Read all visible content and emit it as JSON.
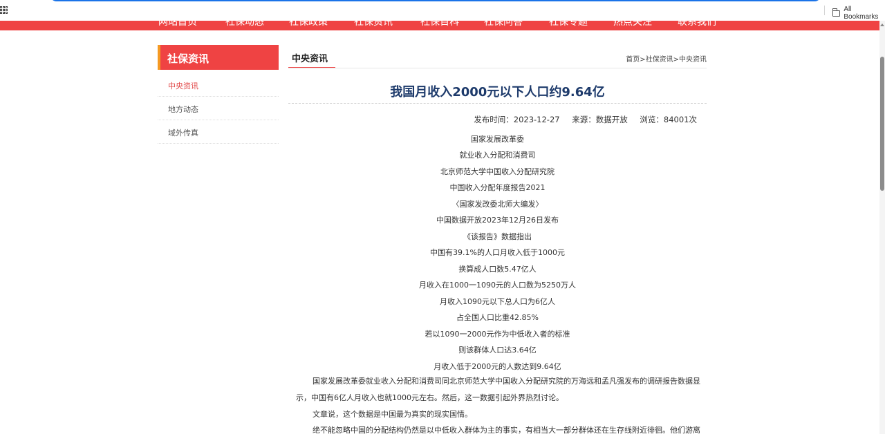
{
  "browser": {
    "all_bookmarks": "All Bookmarks"
  },
  "nav": {
    "items": [
      "网站首页",
      "社保动态",
      "社保政策",
      "社保资讯",
      "社保百科",
      "社保问答",
      "社保专题",
      "热点关注",
      "联系我们"
    ]
  },
  "sidebar": {
    "title": "社保资讯",
    "items": [
      {
        "label": "中央资讯"
      },
      {
        "label": "地方动态"
      },
      {
        "label": "域外传真"
      }
    ]
  },
  "content": {
    "tab": "中央资讯",
    "breadcrumb": {
      "home": "首页",
      "sep1": ">",
      "section": "社保资讯",
      "sep2": ">",
      "current": "中央资讯"
    },
    "title": "我国月收入2000元以下人口约9.64亿",
    "meta": {
      "date": "发布时间：2023-12-27",
      "source": "来源：数据开放",
      "views": "浏览：84001次"
    },
    "lines": [
      "国家发展改革委",
      "就业收入分配和消费司",
      "北京师范大学中国收入分配研究院",
      "中国收入分配年度报告2021",
      "〈国家发改委北师大编发〉",
      "中国数据开放2023年12月26日发布",
      "《该报告》数据指出",
      "中国有39.1%的人口月收入低于1000元",
      "换算成人口数5.47亿人",
      "月收入在1000一1090元的人口数为5250万人",
      "月收入1090元以下总人口为6亿人",
      "占全国人口比重42.85%",
      "若以1090一2000元作为中低收入者的标准",
      "则该群体人口达3.64亿",
      "月收入低于2000元的人数达到9.64亿"
    ],
    "paragraphs": [
      "国家发展改革委就业收入分配和消费司同北京师范大学中国收入分配研究院的万海远和孟凡强发布的调研报告数据显示，中国有6亿人月收入也就1000元左右。然后，这一数据引起外界热烈讨论。",
      "文章说，这个数据是中国最为真实的现实国情。",
      "绝不能忽略中国的分配结构仍然是以中低收入群体为主的事实，有相当大一部分群体还在生存线附近徘徊。他们游离"
    ]
  }
}
